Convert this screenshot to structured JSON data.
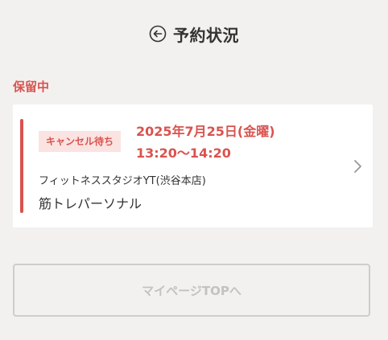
{
  "header": {
    "title": "予約状況",
    "back_icon": "circle-arrow-left-icon"
  },
  "section": {
    "label": "保留中"
  },
  "reservation": {
    "status": "キャンセル待ち",
    "date": "2025年7月25日(金曜)",
    "time": "13:20〜14:20",
    "studio": "フィットネススタジオYT(渋谷本店)",
    "course": "筋トレパーソナル",
    "chevron_icon": "chevron-right-icon"
  },
  "footer": {
    "top_button_label": "マイページTOPへ"
  },
  "colors": {
    "accent": "#d9534f",
    "badge_bg": "#fbe3e1",
    "page_bg": "#f2f1ef",
    "disabled_text": "#c4c2bf"
  }
}
